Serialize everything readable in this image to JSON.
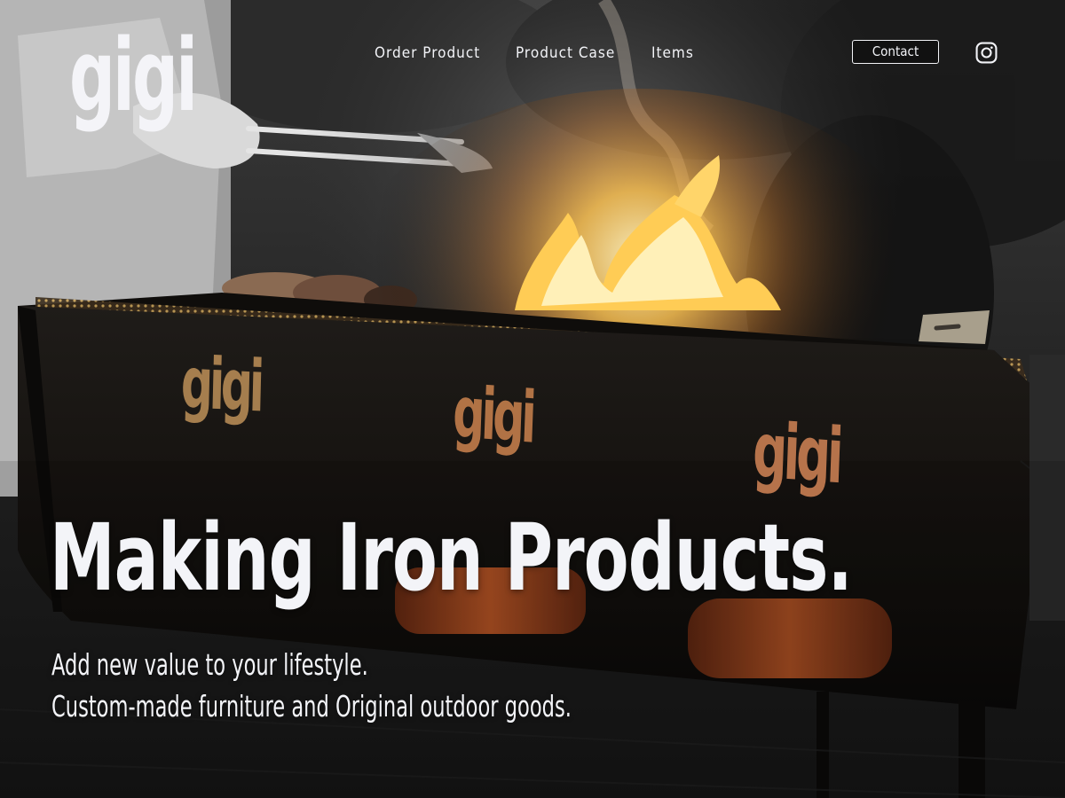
{
  "brand": {
    "logo_text": "gigi"
  },
  "nav": {
    "items": [
      {
        "label": "Order Product"
      },
      {
        "label": "Product Case"
      },
      {
        "label": "Items"
      }
    ],
    "contact_label": "Contact",
    "instagram_icon": "instagram-icon"
  },
  "hero": {
    "headline": "Making Iron Products.",
    "subline_1": "Add new value to your lifestyle.",
    "subline_2": "Custom-made furniture and Original outdoor goods.",
    "background_image": "bbq-grill-with-flames-photo",
    "grill_cutout_text": "gigi"
  },
  "colors": {
    "text": "#f2f3f7",
    "flame": "#ffcc55",
    "flame_core": "#fff4c8",
    "background": "#0e0e0e"
  }
}
